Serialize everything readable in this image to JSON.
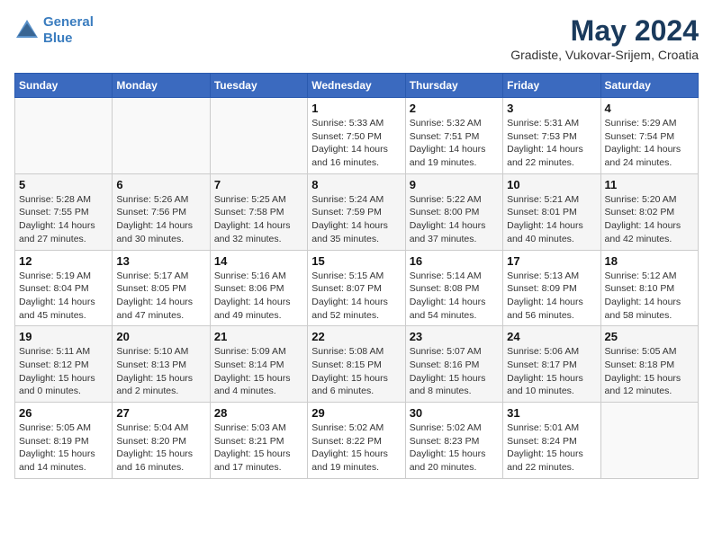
{
  "header": {
    "logo_line1": "General",
    "logo_line2": "Blue",
    "month_title": "May 2024",
    "location": "Gradiste, Vukovar-Srijem, Croatia"
  },
  "days_of_week": [
    "Sunday",
    "Monday",
    "Tuesday",
    "Wednesday",
    "Thursday",
    "Friday",
    "Saturday"
  ],
  "weeks": [
    [
      {
        "day": "",
        "info": ""
      },
      {
        "day": "",
        "info": ""
      },
      {
        "day": "",
        "info": ""
      },
      {
        "day": "1",
        "info": "Sunrise: 5:33 AM\nSunset: 7:50 PM\nDaylight: 14 hours and 16 minutes."
      },
      {
        "day": "2",
        "info": "Sunrise: 5:32 AM\nSunset: 7:51 PM\nDaylight: 14 hours and 19 minutes."
      },
      {
        "day": "3",
        "info": "Sunrise: 5:31 AM\nSunset: 7:53 PM\nDaylight: 14 hours and 22 minutes."
      },
      {
        "day": "4",
        "info": "Sunrise: 5:29 AM\nSunset: 7:54 PM\nDaylight: 14 hours and 24 minutes."
      }
    ],
    [
      {
        "day": "5",
        "info": "Sunrise: 5:28 AM\nSunset: 7:55 PM\nDaylight: 14 hours and 27 minutes."
      },
      {
        "day": "6",
        "info": "Sunrise: 5:26 AM\nSunset: 7:56 PM\nDaylight: 14 hours and 30 minutes."
      },
      {
        "day": "7",
        "info": "Sunrise: 5:25 AM\nSunset: 7:58 PM\nDaylight: 14 hours and 32 minutes."
      },
      {
        "day": "8",
        "info": "Sunrise: 5:24 AM\nSunset: 7:59 PM\nDaylight: 14 hours and 35 minutes."
      },
      {
        "day": "9",
        "info": "Sunrise: 5:22 AM\nSunset: 8:00 PM\nDaylight: 14 hours and 37 minutes."
      },
      {
        "day": "10",
        "info": "Sunrise: 5:21 AM\nSunset: 8:01 PM\nDaylight: 14 hours and 40 minutes."
      },
      {
        "day": "11",
        "info": "Sunrise: 5:20 AM\nSunset: 8:02 PM\nDaylight: 14 hours and 42 minutes."
      }
    ],
    [
      {
        "day": "12",
        "info": "Sunrise: 5:19 AM\nSunset: 8:04 PM\nDaylight: 14 hours and 45 minutes."
      },
      {
        "day": "13",
        "info": "Sunrise: 5:17 AM\nSunset: 8:05 PM\nDaylight: 14 hours and 47 minutes."
      },
      {
        "day": "14",
        "info": "Sunrise: 5:16 AM\nSunset: 8:06 PM\nDaylight: 14 hours and 49 minutes."
      },
      {
        "day": "15",
        "info": "Sunrise: 5:15 AM\nSunset: 8:07 PM\nDaylight: 14 hours and 52 minutes."
      },
      {
        "day": "16",
        "info": "Sunrise: 5:14 AM\nSunset: 8:08 PM\nDaylight: 14 hours and 54 minutes."
      },
      {
        "day": "17",
        "info": "Sunrise: 5:13 AM\nSunset: 8:09 PM\nDaylight: 14 hours and 56 minutes."
      },
      {
        "day": "18",
        "info": "Sunrise: 5:12 AM\nSunset: 8:10 PM\nDaylight: 14 hours and 58 minutes."
      }
    ],
    [
      {
        "day": "19",
        "info": "Sunrise: 5:11 AM\nSunset: 8:12 PM\nDaylight: 15 hours and 0 minutes."
      },
      {
        "day": "20",
        "info": "Sunrise: 5:10 AM\nSunset: 8:13 PM\nDaylight: 15 hours and 2 minutes."
      },
      {
        "day": "21",
        "info": "Sunrise: 5:09 AM\nSunset: 8:14 PM\nDaylight: 15 hours and 4 minutes."
      },
      {
        "day": "22",
        "info": "Sunrise: 5:08 AM\nSunset: 8:15 PM\nDaylight: 15 hours and 6 minutes."
      },
      {
        "day": "23",
        "info": "Sunrise: 5:07 AM\nSunset: 8:16 PM\nDaylight: 15 hours and 8 minutes."
      },
      {
        "day": "24",
        "info": "Sunrise: 5:06 AM\nSunset: 8:17 PM\nDaylight: 15 hours and 10 minutes."
      },
      {
        "day": "25",
        "info": "Sunrise: 5:05 AM\nSunset: 8:18 PM\nDaylight: 15 hours and 12 minutes."
      }
    ],
    [
      {
        "day": "26",
        "info": "Sunrise: 5:05 AM\nSunset: 8:19 PM\nDaylight: 15 hours and 14 minutes."
      },
      {
        "day": "27",
        "info": "Sunrise: 5:04 AM\nSunset: 8:20 PM\nDaylight: 15 hours and 16 minutes."
      },
      {
        "day": "28",
        "info": "Sunrise: 5:03 AM\nSunset: 8:21 PM\nDaylight: 15 hours and 17 minutes."
      },
      {
        "day": "29",
        "info": "Sunrise: 5:02 AM\nSunset: 8:22 PM\nDaylight: 15 hours and 19 minutes."
      },
      {
        "day": "30",
        "info": "Sunrise: 5:02 AM\nSunset: 8:23 PM\nDaylight: 15 hours and 20 minutes."
      },
      {
        "day": "31",
        "info": "Sunrise: 5:01 AM\nSunset: 8:24 PM\nDaylight: 15 hours and 22 minutes."
      },
      {
        "day": "",
        "info": ""
      }
    ]
  ]
}
